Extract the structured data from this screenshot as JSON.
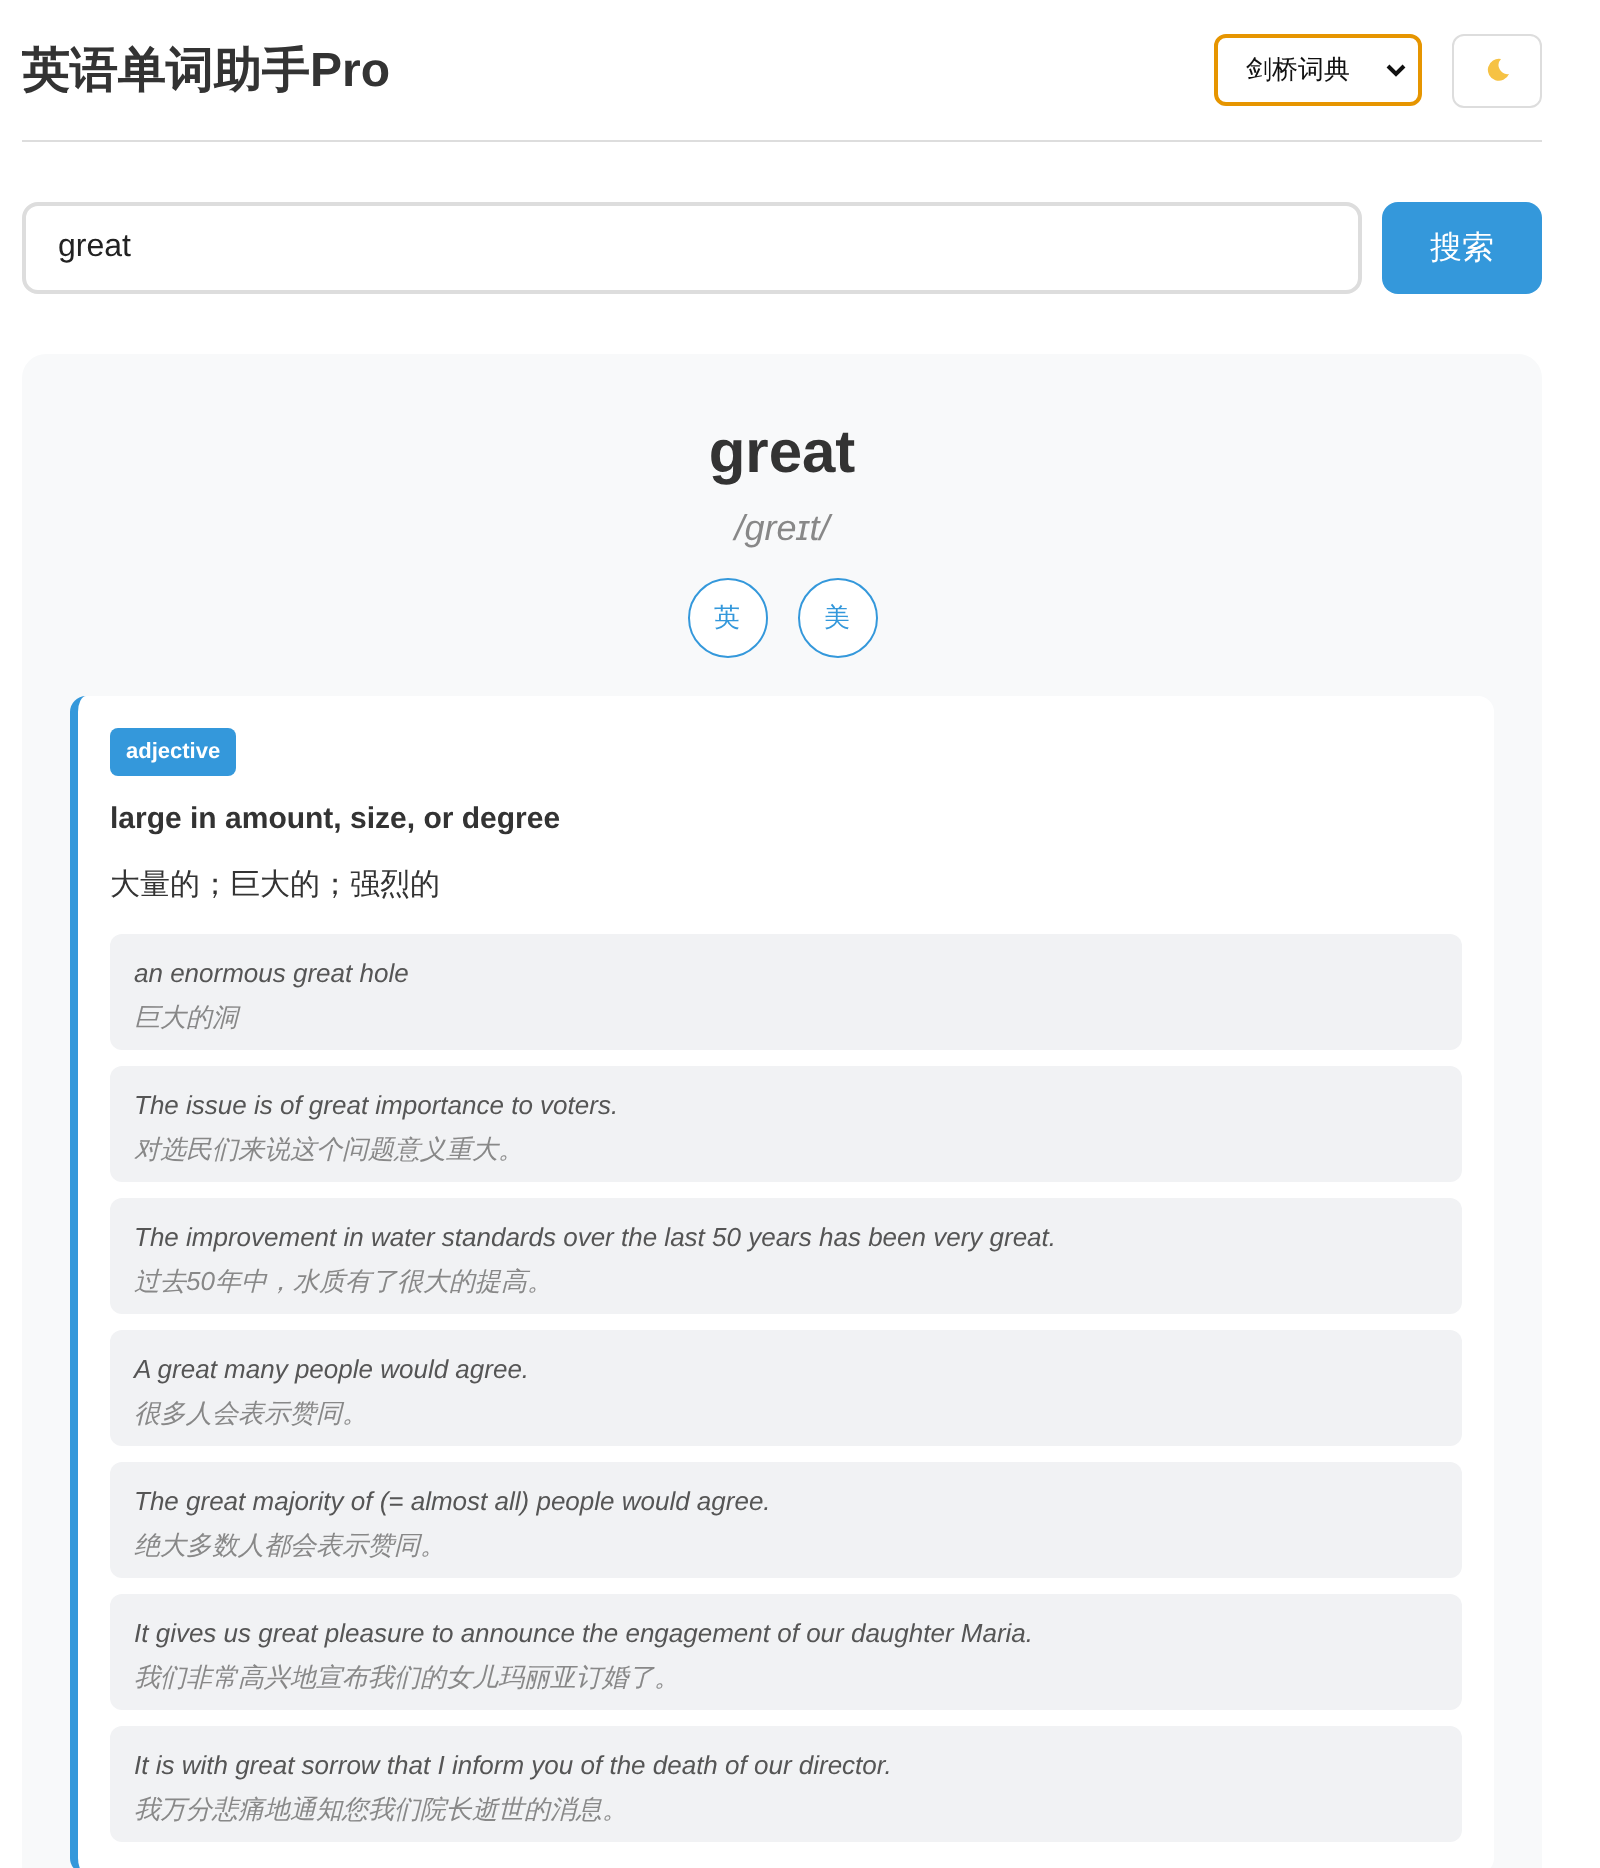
{
  "header": {
    "title": "英语单词助手Pro",
    "dictionary": "剑桥词典"
  },
  "search": {
    "value": "great",
    "button": "搜索"
  },
  "entry": {
    "word": "great",
    "phonetic": "/ɡreɪt/",
    "pronunciations": [
      {
        "label": "英"
      },
      {
        "label": "美"
      }
    ],
    "senses": [
      {
        "part_of_speech": "adjective",
        "definition": "large in amount, size, or degree",
        "translation": "大量的；巨大的；强烈的",
        "examples": [
          {
            "en": "an enormous great hole",
            "zh": "巨大的洞"
          },
          {
            "en": "The issue is of great importance to voters.",
            "zh": "对选民们来说这个问题意义重大。"
          },
          {
            "en": "The improvement in water standards over the last 50 years has been very great.",
            "zh": "过去50年中，水质有了很大的提高。"
          },
          {
            "en": "A great many people would agree.",
            "zh": "很多人会表示赞同。"
          },
          {
            "en": "The great majority of (= almost all) people would agree.",
            "zh": "绝大多数人都会表示赞同。"
          },
          {
            "en": "It gives us great pleasure to announce the engagement of our daughter Maria.",
            "zh": "我们非常高兴地宣布我们的女儿玛丽亚订婚了。"
          },
          {
            "en": "It is with great sorrow that I inform you of the death of our director.",
            "zh": "我万分悲痛地通知您我们院长逝世的消息。"
          }
        ]
      }
    ]
  }
}
